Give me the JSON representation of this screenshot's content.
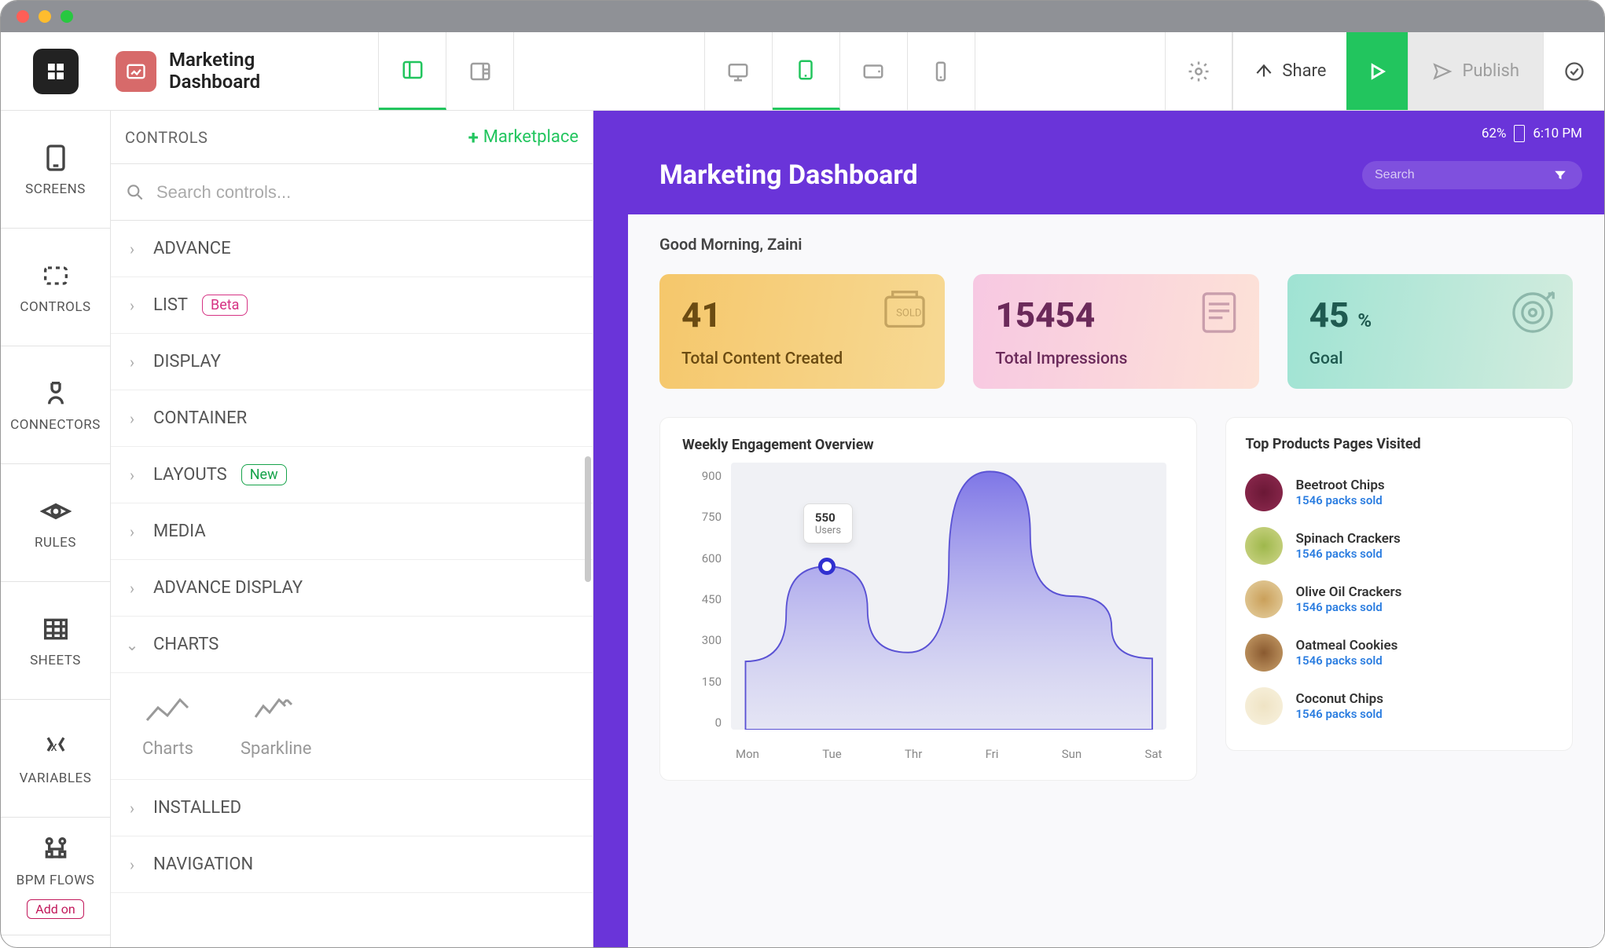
{
  "app": {
    "title_line1": "Marketing",
    "title_line2": "Dashboard"
  },
  "topbar": {
    "share": "Share",
    "publish": "Publish"
  },
  "rail": [
    {
      "label": "SCREENS"
    },
    {
      "label": "CONTROLS"
    },
    {
      "label": "CONNECTORS"
    },
    {
      "label": "RULES"
    },
    {
      "label": "SHEETS"
    },
    {
      "label": "VARIABLES"
    },
    {
      "label": "BPM FLOWS",
      "addon": "Add on"
    }
  ],
  "controls": {
    "header": "CONTROLS",
    "marketplace": "Marketplace",
    "search_placeholder": "Search controls...",
    "groups": [
      {
        "label": "ADVANCE"
      },
      {
        "label": "LIST",
        "badge": "Beta",
        "badge_type": "beta"
      },
      {
        "label": "DISPLAY"
      },
      {
        "label": "CONTAINER"
      },
      {
        "label": "LAYOUTS",
        "badge": "New",
        "badge_type": "new"
      },
      {
        "label": "MEDIA"
      },
      {
        "label": "ADVANCE DISPLAY"
      },
      {
        "label": "CHARTS",
        "expanded": true
      },
      {
        "label": "INSTALLED"
      },
      {
        "label": "NAVIGATION"
      }
    ],
    "chart_tiles": [
      {
        "label": "Charts"
      },
      {
        "label": "Sparkline"
      }
    ]
  },
  "preview": {
    "status": {
      "battery": "62%",
      "time": "6:10 PM"
    },
    "title": "Marketing Dashboard",
    "search_placeholder": "Search",
    "greeting": "Good Morning, Zaini",
    "kpis": [
      {
        "value": "41",
        "label": "Total Content Created"
      },
      {
        "value": "15454",
        "label": "Total Impressions"
      },
      {
        "value": "45",
        "suffix": "%",
        "label": "Goal"
      }
    ],
    "chart": {
      "title": "Weekly Engagement Overview",
      "tooltip_value": "550",
      "tooltip_label": "Users"
    },
    "products": {
      "title": "Top Products Pages Visited",
      "items": [
        {
          "name": "Beetroot Chips",
          "sub": "1546 packs sold",
          "cls": "p-beet"
        },
        {
          "name": "Spinach Crackers",
          "sub": "1546 packs sold",
          "cls": "p-spin"
        },
        {
          "name": "Olive Oil Crackers",
          "sub": "1546 packs sold",
          "cls": "p-oil"
        },
        {
          "name": "Oatmeal Cookies",
          "sub": "1546 packs sold",
          "cls": "p-oat"
        },
        {
          "name": "Coconut Chips",
          "sub": "1546 packs sold",
          "cls": "p-coco"
        }
      ]
    }
  },
  "chart_data": {
    "type": "area",
    "title": "Weekly Engagement Overview",
    "xlabel": "",
    "ylabel": "",
    "ylim": [
      0,
      900
    ],
    "y_ticks": [
      900,
      750,
      600,
      450,
      300,
      150,
      0
    ],
    "categories": [
      "Mon",
      "Tue",
      "Thr",
      "Fri",
      "Sun",
      "Sat"
    ],
    "values": [
      230,
      550,
      260,
      870,
      450,
      240
    ],
    "tooltip": {
      "category": "Tue",
      "value": 550,
      "label": "Users"
    }
  }
}
